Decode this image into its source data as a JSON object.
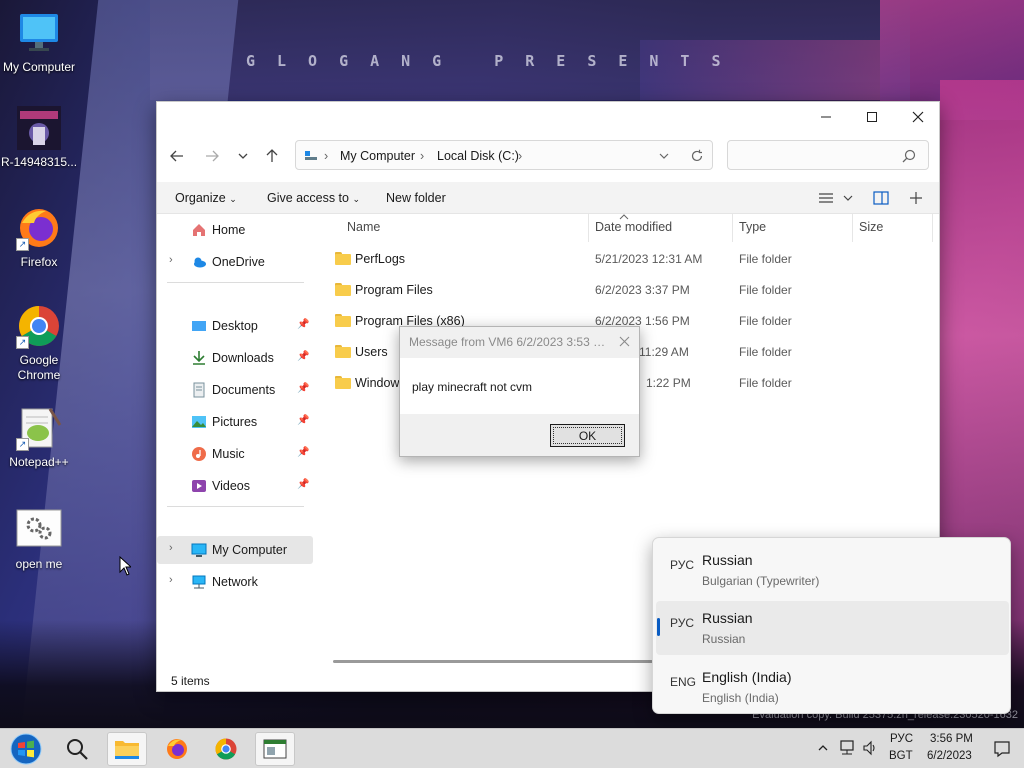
{
  "desktop": {
    "wallpaper_title": "GLOGANG PRESENTS",
    "watermark": "Evaluation copy. Build 25375.zn_release.230520-1632",
    "icons": [
      {
        "label": "My Computer"
      },
      {
        "label": "R-14948315..."
      },
      {
        "label": "Firefox"
      },
      {
        "label": "Google Chrome"
      },
      {
        "label": "Notepad++"
      },
      {
        "label": "open me"
      }
    ]
  },
  "explorer": {
    "breadcrumb": [
      "My Computer",
      "Local Disk (C:)"
    ],
    "search_placeholder": "",
    "toolbar": {
      "organize": "Organize",
      "give_access": "Give access to",
      "new_folder": "New folder"
    },
    "sidebar": {
      "home": "Home",
      "onedrive": "OneDrive",
      "pinned": [
        "Desktop",
        "Downloads",
        "Documents",
        "Pictures",
        "Music",
        "Videos"
      ],
      "my_computer": "My Computer",
      "network": "Network"
    },
    "columns": {
      "name": "Name",
      "date": "Date modified",
      "type": "Type",
      "size": "Size"
    },
    "files": [
      {
        "name": "PerfLogs",
        "date": "5/21/2023 12:31 AM",
        "type": "File folder"
      },
      {
        "name": "Program Files",
        "date": "6/2/2023 3:37 PM",
        "type": "File folder"
      },
      {
        "name": "Program Files (x86)",
        "date": "6/2/2023 1:56 PM",
        "type": "File folder"
      },
      {
        "name": "Users",
        "date": "11:29 AM",
        "type": "File folder"
      },
      {
        "name": "Windows",
        "date": "1:22 PM",
        "type": "File folder"
      }
    ],
    "status": "5 items"
  },
  "dialog": {
    "title": "Message from VM6 6/2/2023 3:53 P...",
    "message": "play minecraft not cvm",
    "ok_label": "OK"
  },
  "language_flyout": {
    "items": [
      {
        "code": "РУС",
        "name": "Russian",
        "layout": "Bulgarian (Typewriter)",
        "active": false
      },
      {
        "code": "РУС",
        "name": "Russian",
        "layout": "Russian",
        "active": true
      },
      {
        "code": "ENG",
        "name": "English (India)",
        "layout": "English (India)",
        "active": false
      }
    ]
  },
  "taskbar": {
    "lang_code": "РУС",
    "lang_layout": "BGT",
    "time": "3:56 PM",
    "date": "6/2/2023"
  },
  "colors": {
    "accent": "#0a5cc2",
    "folder": "#f8cc4b"
  }
}
